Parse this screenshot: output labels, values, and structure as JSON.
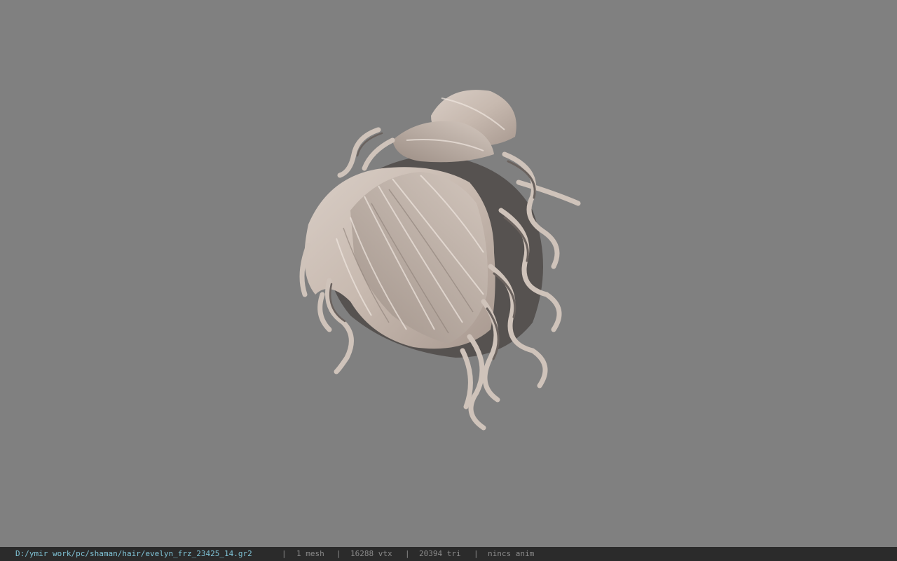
{
  "viewport": {
    "background_color": "#808080",
    "model_name": "hair-model",
    "hair_color": "#c9bcb3"
  },
  "statusbar": {
    "file_path": "D:/ymir work/pc/shaman/hair/evelyn_frz_23425_14.gr2",
    "separator": "|",
    "mesh_count": "1 mesh",
    "vertex_count": "16288 vtx",
    "triangle_count": "20394 tri",
    "anim": "nincs anim",
    "path_color": "#7fc3d6",
    "text_color": "#8a8a8a"
  }
}
